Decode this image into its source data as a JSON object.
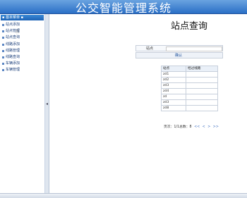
{
  "header": {
    "title": "公交智能管理系统"
  },
  "sidebar": {
    "header_label": "▪ 基本菜单 ▪",
    "items": [
      {
        "label": "站点添加"
      },
      {
        "label": "站点管理"
      },
      {
        "label": "站点查询"
      },
      {
        "label": "线路添加"
      },
      {
        "label": "线路管理"
      },
      {
        "label": "线路查询"
      },
      {
        "label": "车辆添加"
      },
      {
        "label": "车辆管理"
      }
    ]
  },
  "main": {
    "title": "站点查询",
    "search": {
      "label": "站点",
      "value": "",
      "button_label": "确认"
    },
    "table": {
      "headers": [
        "站点",
        "经过线路"
      ],
      "rows": [
        [
          "zd1",
          ""
        ],
        [
          "zd2",
          ""
        ],
        [
          "zd3",
          ""
        ],
        [
          "zd4",
          ""
        ],
        [
          "zd",
          ""
        ],
        [
          "zd3",
          ""
        ],
        [
          "zd8",
          ""
        ]
      ]
    },
    "pager": {
      "text": "页次：1/1总数：8",
      "first": "<<",
      "prev": "<",
      "next": ">",
      "last": ">>"
    }
  }
}
